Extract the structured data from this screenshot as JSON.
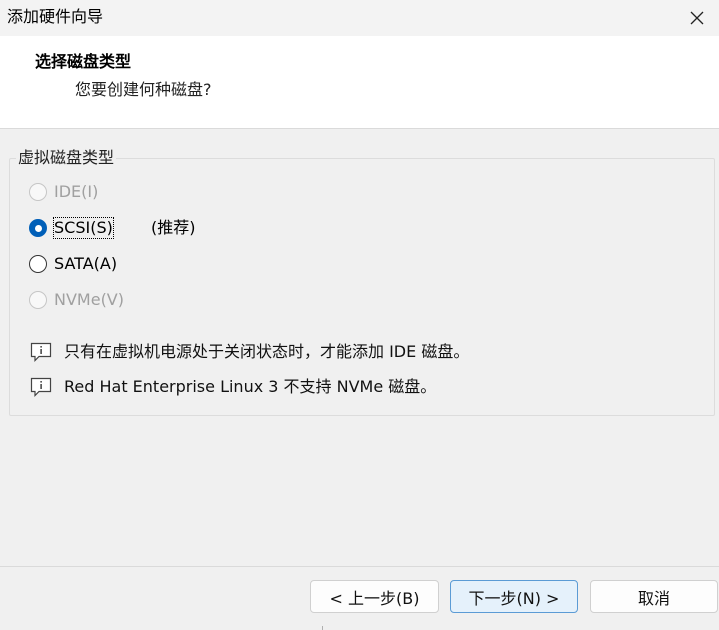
{
  "window": {
    "title": "添加硬件向导"
  },
  "header": {
    "title": "选择磁盘类型",
    "subtitle": "您要创建何种磁盘?"
  },
  "group": {
    "legend": "虚拟磁盘类型",
    "options": [
      {
        "label": "IDE(I)",
        "checked": false,
        "disabled": true
      },
      {
        "label": "SCSI(S)",
        "checked": true,
        "disabled": false
      },
      {
        "label": "SATA(A)",
        "checked": false,
        "disabled": false
      },
      {
        "label": "NVMe(V)",
        "checked": false,
        "disabled": true
      }
    ],
    "recommend": "(推荐)",
    "info": [
      "只有在虚拟机电源处于关闭状态时，才能添加 IDE 磁盘。",
      "Red Hat Enterprise Linux 3 不支持 NVMe 磁盘。"
    ]
  },
  "buttons": {
    "back": "< 上一步(B)",
    "next": "下一步(N) >",
    "cancel": "取消"
  },
  "colors": {
    "accent": "#005fb8",
    "panel": "#f0f0f0"
  },
  "icons": {
    "close": "close-icon",
    "info": "info-icon"
  }
}
